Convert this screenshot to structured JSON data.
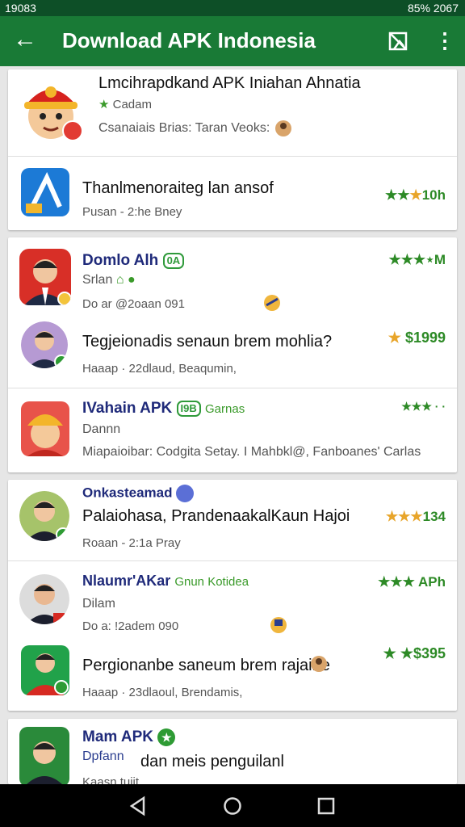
{
  "status": {
    "left": "19083",
    "right": "85% 2067"
  },
  "appbar": {
    "title": "Download APK Indonesia",
    "back_glyph": "←",
    "menu_glyph": "⋮"
  },
  "items": [
    {
      "name": "Lmcihrapdkand APK Iniahan Ahnatia",
      "meta": "Cadam",
      "sub": "Csanaiais Brias: Taran Veoks:"
    },
    {
      "name": "Thanlmenoraiteg lan ansof",
      "rating": "10h",
      "sub": "Pusan - 2:he Bney"
    },
    {
      "name": "Domlo Alh",
      "badge": "0A",
      "rating": "⋆M",
      "meta": "Srlan",
      "sub": "Do ar @2oaan 091"
    },
    {
      "name": "Tegjeionadis senaun brem mohlia?",
      "rating": "$1999",
      "sub": "Haaap · 22dlaud, Beaqumin,"
    },
    {
      "name": "IVahain APK",
      "badge": "I9B",
      "extra": "Garnas",
      "rating": "★★★ · ·",
      "meta": "Dannn",
      "sub": "Miapaioibar: Codgita Setay. I Mahbkl@, Fanboanes' Carlas"
    },
    {
      "name": "Onkasteamad",
      "big": "Palaiohasa, PrandenaakalKaun Hajoi",
      "rating": "134",
      "sub": "Roaan - 2:1a Pray"
    },
    {
      "name": "Nlaumr'AKar",
      "extra": "Gnun Kotidea",
      "rating": "APh",
      "meta": "Dilam",
      "sub": "Do a: !2adem 090"
    },
    {
      "name": "Pergionanbe saneum brem rajaine",
      "rating": "★$395",
      "sub": "Haaap · 23dlaoul, Brendamis,"
    },
    {
      "name": "Mam APK",
      "meta": "Dpfann",
      "big": "dan meis penguilanl",
      "sub": "Kaasn tuiit"
    }
  ]
}
